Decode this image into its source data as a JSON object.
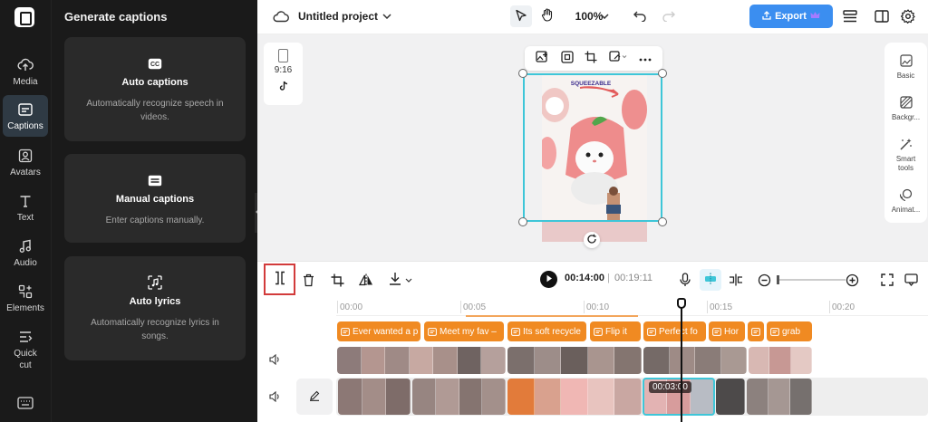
{
  "nav": {
    "items": [
      {
        "label": "Media",
        "icon": "cloud-upload-icon"
      },
      {
        "label": "Captions",
        "icon": "captions-icon"
      },
      {
        "label": "Avatars",
        "icon": "avatar-icon"
      },
      {
        "label": "Text",
        "icon": "text-icon"
      },
      {
        "label": "Audio",
        "icon": "music-note-icon"
      },
      {
        "label": "Elements",
        "icon": "elements-icon"
      },
      {
        "label": "Quick\ncut",
        "icon": "quick-cut-icon"
      }
    ],
    "active": "Captions"
  },
  "panel": {
    "title": "Generate captions",
    "cards": [
      {
        "title": "Auto captions",
        "desc": "Automatically recognize speech in videos.",
        "icon": "cc-icon"
      },
      {
        "title": "Manual captions",
        "desc": "Enter captions manually.",
        "icon": "keyboard-icon"
      },
      {
        "title": "Auto lyrics",
        "desc": "Automatically recognize lyrics in songs.",
        "icon": "lyrics-icon"
      }
    ]
  },
  "topbar": {
    "project_name": "Untitled project",
    "zoom": "100%",
    "export_label": "Export"
  },
  "canvas": {
    "ratio": "9:16",
    "right_tools": [
      "Basic",
      "Backgr...",
      "Smart tools",
      "Animat..."
    ]
  },
  "timeline": {
    "current_time": "00:14:00",
    "separator": "|",
    "total_time": "00:19:11",
    "ruler": [
      "00:00",
      "00:05",
      "00:10",
      "00:15",
      "00:20"
    ],
    "clip_time": "00:03:00",
    "captions": [
      "Ever wanted a p",
      "Meet my fav –",
      "Its soft recycle",
      "Flip it",
      "Perfect fo",
      "Hor",
      "",
      "grab"
    ]
  },
  "colors": {
    "accent": "#3b8ef0",
    "caption_chip": "#f08a22",
    "selection": "#3ec6d8",
    "split_highlight": "#d23b3b"
  }
}
